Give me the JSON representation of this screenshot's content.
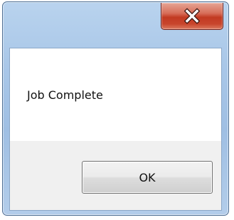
{
  "window": {
    "close_icon": "close-icon"
  },
  "dialog": {
    "message": "Job Complete",
    "ok_label": "OK"
  },
  "colors": {
    "close_button": "#c7402a",
    "frame": "#a9c7e8",
    "button_area": "#f0f0f0"
  }
}
